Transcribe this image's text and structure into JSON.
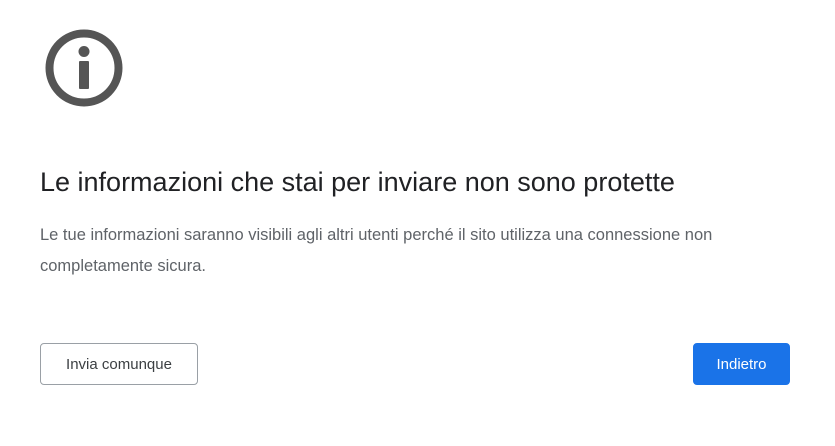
{
  "icon": "info-circle-icon",
  "colors": {
    "icon": "#555555",
    "primary_button": "#1a73e8",
    "title_text": "#202124",
    "body_text": "#5f6368"
  },
  "interstitial": {
    "title": "Le informazioni che stai per inviare non sono protette",
    "description": "Le tue informazioni saranno visibili agli altri utenti perché il sito utilizza una connessione non completamente sicura."
  },
  "buttons": {
    "proceed_label": "Invia comunque",
    "back_label": "Indietro"
  }
}
